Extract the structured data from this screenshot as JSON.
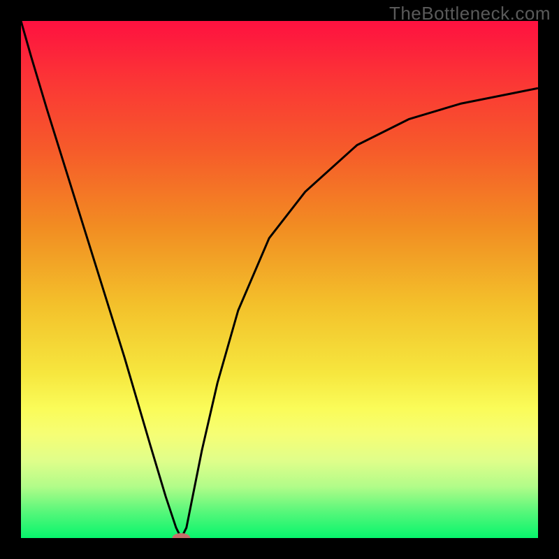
{
  "watermark": "TheBottleneck.com",
  "chart_data": {
    "type": "area",
    "title": "",
    "xlabel": "",
    "ylabel": "",
    "xlim": [
      0,
      100
    ],
    "ylim": [
      0,
      100
    ],
    "gradient_stops": [
      {
        "offset": 0,
        "color": "#fe1140"
      },
      {
        "offset": 12,
        "color": "#fb3735"
      },
      {
        "offset": 25,
        "color": "#f65b2a"
      },
      {
        "offset": 40,
        "color": "#f28d22"
      },
      {
        "offset": 55,
        "color": "#f3c12b"
      },
      {
        "offset": 68,
        "color": "#f6e63e"
      },
      {
        "offset": 75,
        "color": "#fafc59"
      },
      {
        "offset": 80,
        "color": "#f6fe75"
      },
      {
        "offset": 85,
        "color": "#e0fe8a"
      },
      {
        "offset": 90,
        "color": "#b2fc89"
      },
      {
        "offset": 95,
        "color": "#56f77a"
      },
      {
        "offset": 100,
        "color": "#07f56c"
      }
    ],
    "series": [
      {
        "name": "curve",
        "x": [
          0,
          2,
          5,
          10,
          15,
          20,
          25,
          28,
          30,
          31,
          32,
          33,
          35,
          38,
          42,
          48,
          55,
          65,
          75,
          85,
          95,
          100
        ],
        "values": [
          100,
          93,
          83,
          67,
          51,
          35,
          18,
          8,
          2,
          0,
          2,
          7,
          17,
          30,
          44,
          58,
          67,
          76,
          81,
          84,
          86,
          87
        ]
      }
    ],
    "marker": {
      "x": 31,
      "y": 0,
      "color": "#c5706a"
    }
  }
}
